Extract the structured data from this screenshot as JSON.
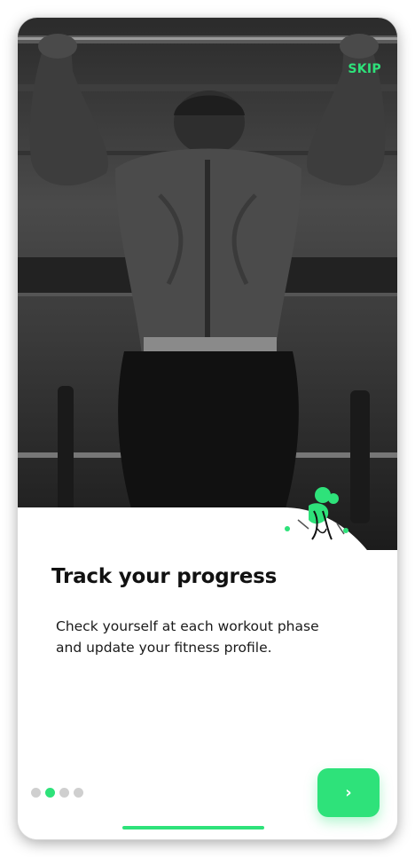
{
  "header": {
    "skip_label": "SKIP"
  },
  "onboarding": {
    "title": "Track your progress",
    "description": "Check yourself at each workout phase and update your fitness profile.",
    "page_count": 4,
    "active_page": 2
  },
  "icons": {
    "next": "chevron-right-icon",
    "illustration": "fitness-illustration-icon"
  },
  "colors": {
    "accent": "#2ee27a",
    "dot_inactive": "#cfcfcf",
    "title": "#111111"
  }
}
